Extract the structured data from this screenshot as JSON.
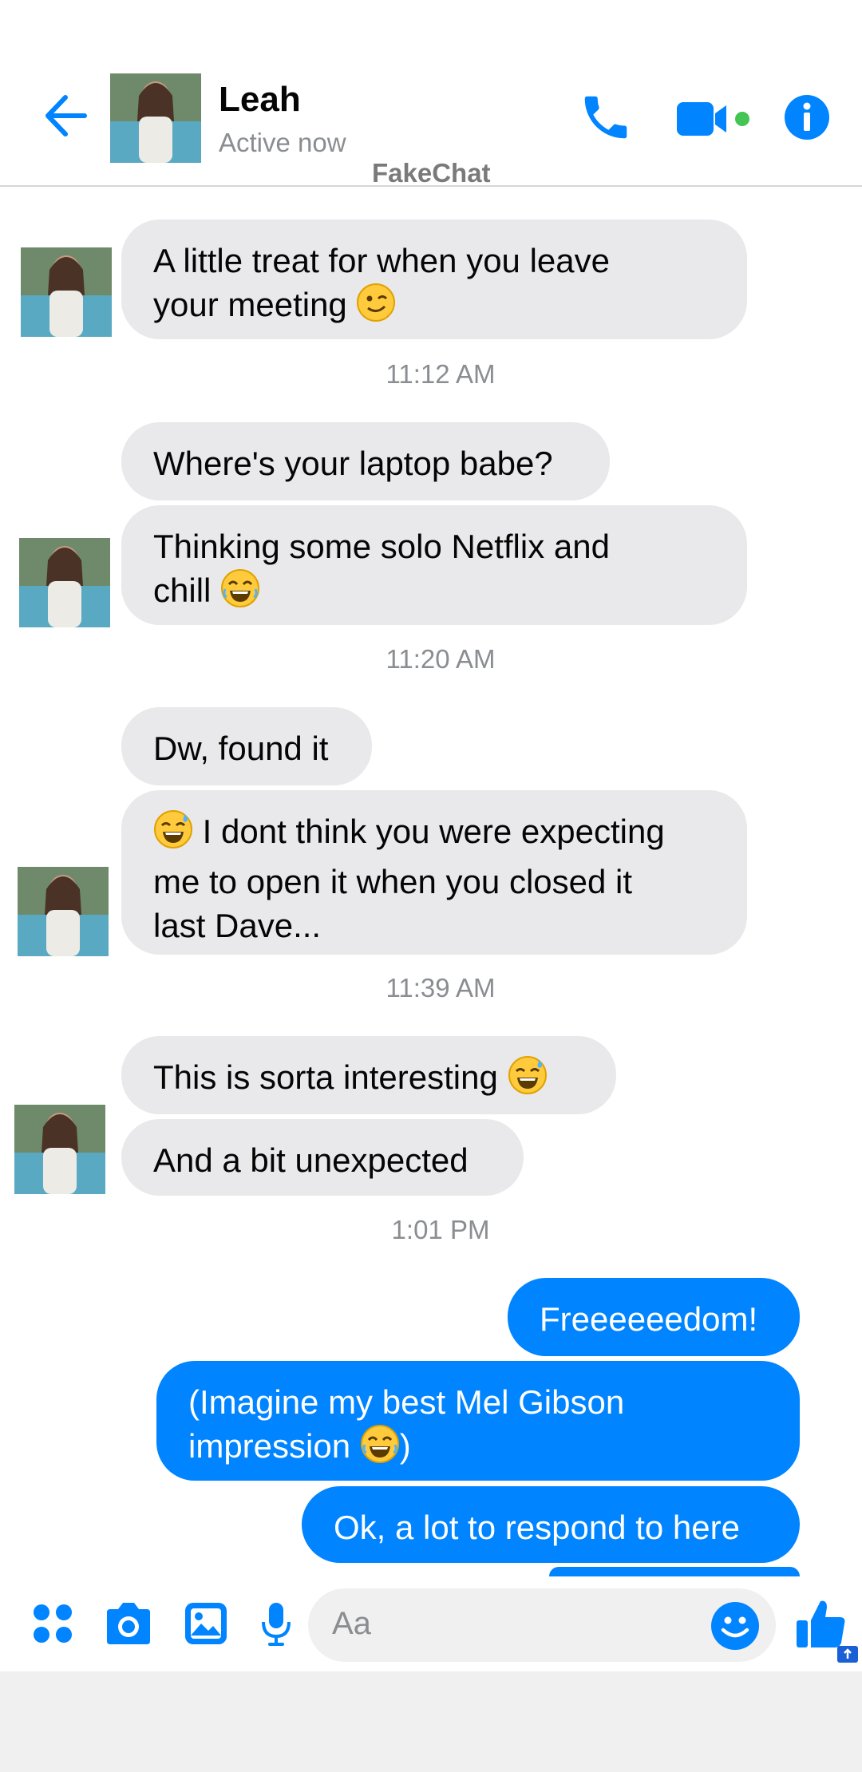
{
  "header": {
    "contact_name": "Leah",
    "status": "Active now",
    "watermark": "FakeChat"
  },
  "messages": [
    {
      "from": "them",
      "lines": [
        "A little treat for when you leave",
        "your meeting"
      ],
      "emoji": "winking-face"
    },
    {
      "timestamp": "11:12 AM"
    },
    {
      "from": "them",
      "text": "Where's your laptop babe?"
    },
    {
      "from": "them",
      "lines": [
        "Thinking some solo Netflix and",
        "chill"
      ],
      "emoji": "laughing-face"
    },
    {
      "timestamp": "11:20 AM"
    },
    {
      "from": "them",
      "text": "Dw, found it"
    },
    {
      "from": "them",
      "lines": [
        "I dont think you were expecting",
        "me to open it when you closed it",
        "last Dave..."
      ],
      "emoji": "sweat-smile-face"
    },
    {
      "timestamp": "11:39 AM"
    },
    {
      "from": "them",
      "text": "This is sorta interesting",
      "emoji": "sweat-smile-face"
    },
    {
      "from": "them",
      "text": "And a bit unexpected"
    },
    {
      "timestamp": "1:01 PM"
    },
    {
      "from": "me",
      "text": "Freeeeeedom!"
    },
    {
      "from": "me",
      "lines": [
        "(Imagine my best Mel Gibson",
        "impression"
      ],
      "emoji": "laughing-face",
      "tail": ")"
    },
    {
      "from": "me",
      "text": "Ok, a lot to respond to here"
    }
  ],
  "composer": {
    "placeholder": "Aa"
  },
  "colors": {
    "accent": "#0084ff",
    "incoming_bubble": "#e9e9eb",
    "online": "#44c553"
  },
  "icons": [
    "back-arrow-icon",
    "phone-icon",
    "video-camera-icon",
    "info-icon",
    "apps-icon",
    "camera-icon",
    "gallery-icon",
    "microphone-icon",
    "smiley-icon",
    "thumbs-up-icon"
  ]
}
